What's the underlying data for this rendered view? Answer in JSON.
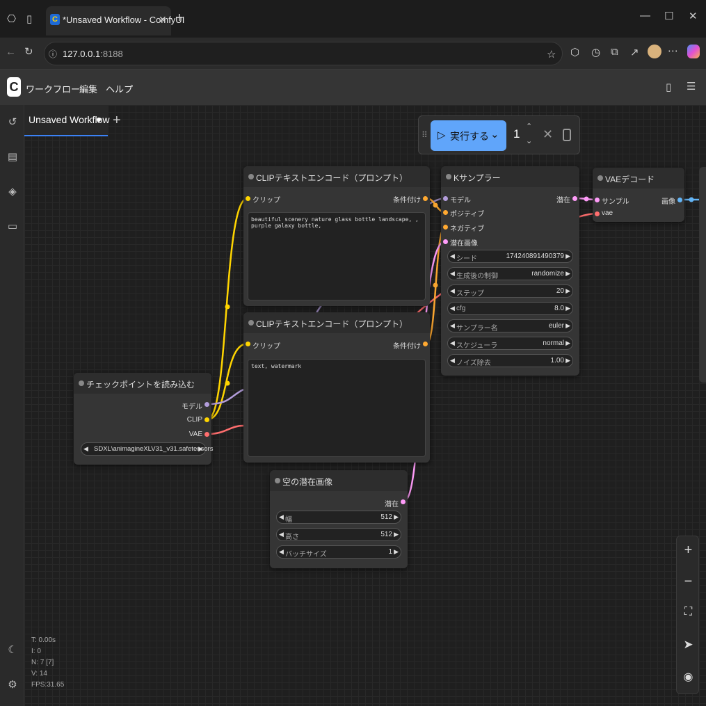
{
  "browser": {
    "tab_title": "*Unsaved Workflow - ComfyUI",
    "url_host": "127.0.0.1",
    "url_port": ":8188",
    "favicon_letter": "C"
  },
  "menu": {
    "items": [
      "ワークフロー",
      "編集",
      "ヘルプ"
    ]
  },
  "workflow_tab": {
    "label": "Unsaved Workflow"
  },
  "run": {
    "label": "実行する",
    "count": "1"
  },
  "nodes": {
    "clip1": {
      "title": "CLIPテキストエンコード（プロンプト）",
      "input": "クリップ",
      "output": "条件付け",
      "text": "beautiful scenery nature glass bottle landscape, , purple galaxy bottle,"
    },
    "clip2": {
      "title": "CLIPテキストエンコード（プロンプト）",
      "input": "クリップ",
      "output": "条件付け",
      "text": "text, watermark"
    },
    "ksampler": {
      "title": "Kサンプラー",
      "inputs": [
        "モデル",
        "ポジティブ",
        "ネガティブ",
        "潜在画像"
      ],
      "output": "潜在",
      "widgets": [
        {
          "label": "シード",
          "value": "174240891490379"
        },
        {
          "label": "生成後の制御",
          "value": "randomize"
        },
        {
          "label": "ステップ",
          "value": "20"
        },
        {
          "label": "cfg",
          "value": "8.0"
        },
        {
          "label": "サンプラー名",
          "value": "euler"
        },
        {
          "label": "スケジューラ",
          "value": "normal"
        },
        {
          "label": "ノイズ除去",
          "value": "1.00"
        }
      ]
    },
    "vae": {
      "title": "VAEデコード",
      "inputs": [
        "サンプル",
        "vae"
      ],
      "output": "画像"
    },
    "checkpoint": {
      "title": "チェックポイントを読み込む",
      "outputs": [
        "モデル",
        "CLIP",
        "VAE"
      ],
      "ckpt": "SDXL\\animagineXLV31_v31.safetensors"
    },
    "latent": {
      "title": "空の潜在画像",
      "output": "潜在",
      "widgets": [
        {
          "label": "幅",
          "value": "512"
        },
        {
          "label": "高さ",
          "value": "512"
        },
        {
          "label": "バッチサイズ",
          "value": "1"
        }
      ]
    }
  },
  "stats": [
    "T: 0.00s",
    "I: 0",
    "N: 7 [7]",
    "V: 14",
    "FPS:31.65"
  ],
  "colors": {
    "accent": "#60a5fa",
    "clip_link": "#ffd500",
    "model_link": "#b39ddb",
    "vae_link": "#ff6e6e",
    "latent_link": "#ff9cf9",
    "cond_link": "#ffa931",
    "image_link": "#64b5f6"
  }
}
